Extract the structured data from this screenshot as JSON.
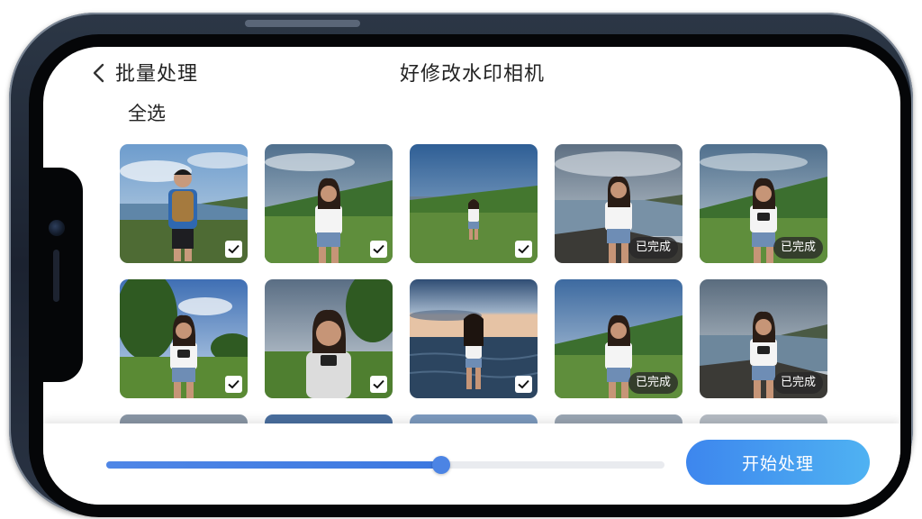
{
  "header": {
    "back_icon": "chevron-left-icon",
    "nav_title": "批量处理",
    "app_title": "好修改水印相机"
  },
  "toolbar": {
    "select_all_label": "全选"
  },
  "photos": [
    {
      "scene": "man-backpack",
      "status": "checked"
    },
    {
      "scene": "girl-hill",
      "status": "checked"
    },
    {
      "scene": "girl-far-field",
      "status": "checked"
    },
    {
      "scene": "girl-beach",
      "status": "done",
      "badge": "已完成"
    },
    {
      "scene": "girl-hill-camera",
      "status": "done",
      "badge": "已完成"
    },
    {
      "scene": "girl-trees",
      "status": "checked"
    },
    {
      "scene": "girl-closeup",
      "status": "checked"
    },
    {
      "scene": "girl-sea-back",
      "status": "checked"
    },
    {
      "scene": "girl-hill-smile",
      "status": "done",
      "badge": "已完成"
    },
    {
      "scene": "girl-shore",
      "status": "done",
      "badge": "已完成"
    }
  ],
  "bottom": {
    "progress": 0.6,
    "start_button_label": "开始处理"
  },
  "colors": {
    "accent": "#3d86ee",
    "badge_bg": "#333333"
  }
}
